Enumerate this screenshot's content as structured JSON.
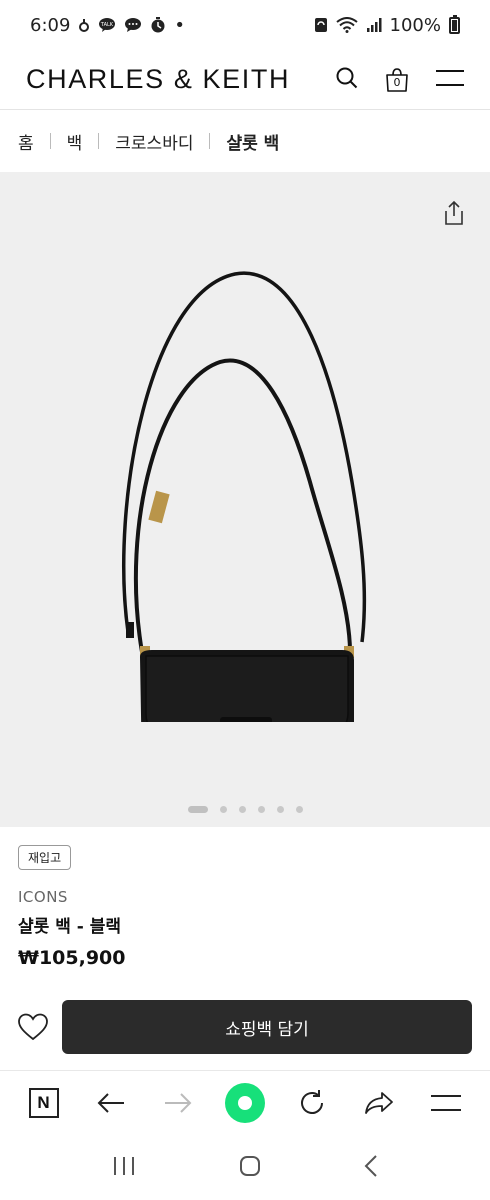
{
  "status_bar": {
    "time": "6:09",
    "talk_label": "TALK",
    "dot": "•",
    "battery_percent": "100%",
    "icons": [
      "notification-icon",
      "talk-icon",
      "chat-icon",
      "timer-icon",
      "sync-icon",
      "wifi-icon",
      "signal-icon",
      "battery-icon"
    ]
  },
  "header": {
    "brand": "CHARLES & KEITH",
    "cart_count": "0",
    "icons": [
      "search-icon",
      "shopping-bag-icon",
      "menu-icon"
    ]
  },
  "breadcrumb": {
    "items": [
      "홈",
      "백",
      "크로스바디",
      "샬롯 백"
    ]
  },
  "gallery": {
    "image_count": 6,
    "active_index": 0,
    "icons": [
      "share-icon"
    ]
  },
  "product": {
    "badge": "재입고",
    "collection": "ICONS",
    "name": "샬롯 백 - 블랙",
    "price": "₩105,900"
  },
  "actions": {
    "add_to_cart": "쇼핑백 담기",
    "icons": [
      "heart-icon"
    ]
  },
  "browser_toolbar": {
    "n_label": "N",
    "icons": [
      "naver-n-icon",
      "back-arrow-icon",
      "forward-arrow-icon",
      "green-dot-icon",
      "reload-icon",
      "share-arrow-icon",
      "menu-icon"
    ]
  },
  "system_nav": {
    "icons": [
      "recents-icon",
      "home-icon",
      "back-icon"
    ]
  },
  "colors": {
    "gallery_bg": "#efefef",
    "cart_button_bg": "#2b2b2b",
    "green_accent": "#17e07a"
  }
}
